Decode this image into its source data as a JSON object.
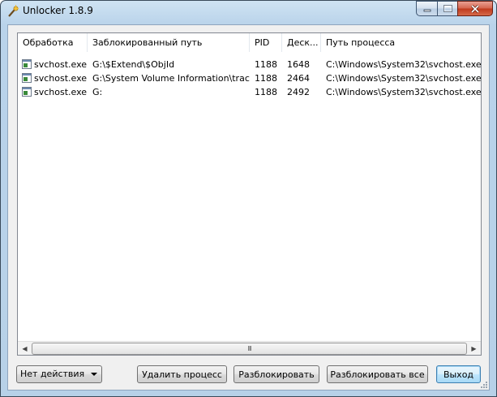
{
  "window": {
    "title": "Unlocker 1.8.9",
    "icon": "magic-wand-icon"
  },
  "titlebar_buttons": {
    "minimize_icon": "minimize-icon",
    "maximize_icon": "maximize-icon",
    "close_icon": "close-icon"
  },
  "table": {
    "columns": [
      "Обработка",
      "Заблокированный путь",
      "PID",
      "Деск...",
      "Путь процесса"
    ],
    "rows": [
      {
        "process": "svchost.exe",
        "locked_path": "G:\\$Extend\\$ObjId",
        "pid": "1188",
        "handle": "1648",
        "process_path": "C:\\Windows\\System32\\svchost.exe"
      },
      {
        "process": "svchost.exe",
        "locked_path": "G:\\System Volume Information\\tracki...",
        "pid": "1188",
        "handle": "2464",
        "process_path": "C:\\Windows\\System32\\svchost.exe"
      },
      {
        "process": "svchost.exe",
        "locked_path": "G:",
        "pid": "1188",
        "handle": "2492",
        "process_path": "C:\\Windows\\System32\\svchost.exe"
      }
    ],
    "row_icon": "exe-window-icon"
  },
  "scrollbar": {
    "left_arrow": "◀",
    "right_arrow": "▶",
    "thumb_grip": "III"
  },
  "footer": {
    "action_select": "Нет действия",
    "kill_process": "Удалить процесс",
    "unlock": "Разблокировать",
    "unlock_all": "Разблокировать все",
    "exit": "Выход"
  },
  "colors": {
    "titlebar": "#b9d3ea",
    "close_button": "#c0391d",
    "default_button_border": "#3c7fb1"
  }
}
